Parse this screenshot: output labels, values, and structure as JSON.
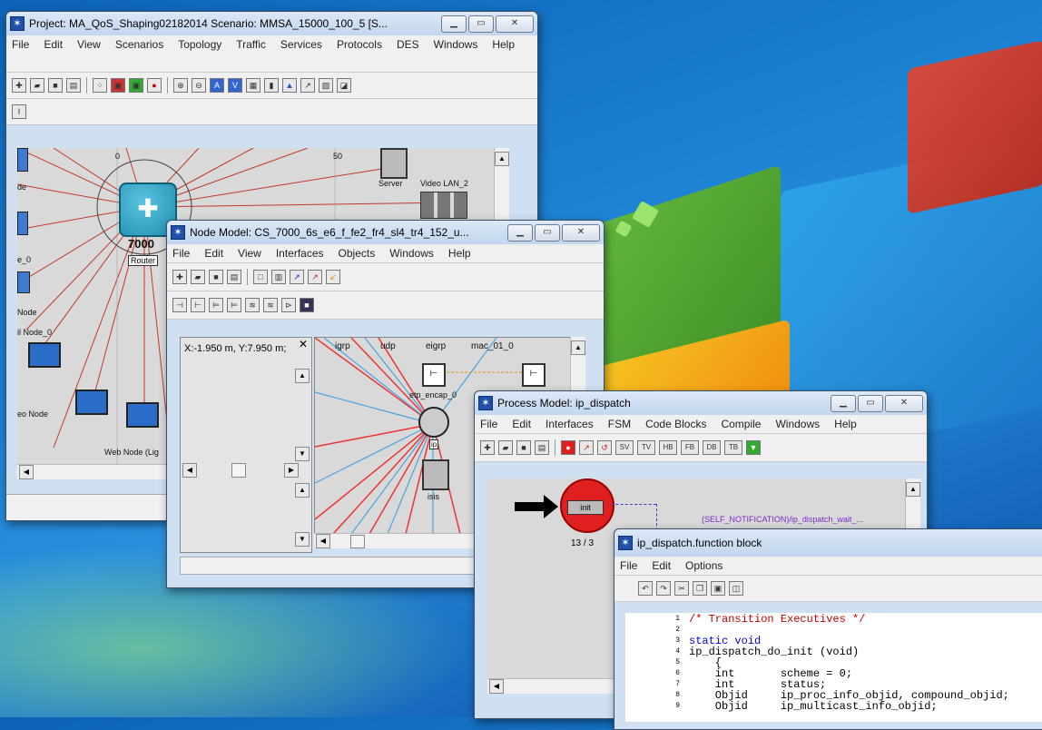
{
  "project_window": {
    "title": "Project: MA_QoS_Shaping02182014 Scenario: MMSA_15000_100_5  [S...",
    "menu": [
      "File",
      "Edit",
      "View",
      "Scenarios",
      "Topology",
      "Traffic",
      "Services",
      "Protocols",
      "DES",
      "Windows",
      "Help"
    ],
    "labels": {
      "ruler_0": "0",
      "ruler_50": "50",
      "server": "Server",
      "video_lan": "Video LAN_2",
      "router_name": "7000",
      "router_tip": "Router",
      "node_left_1": "de",
      "node_left_2": "e_0",
      "node_left_3": "Node",
      "node_left_4": "il Node_0",
      "video_node": "eo Node",
      "web_node": "Web Node (Lig"
    }
  },
  "node_window": {
    "title": "Node Model: CS_7000_6s_e6_f_fe2_fr4_sl4_tr4_152_u...",
    "menu": [
      "File",
      "Edit",
      "View",
      "Interfaces",
      "Objects",
      "Windows",
      "Help"
    ],
    "coords": "X:-1.950 m, Y:7.950 m;",
    "labels": {
      "igrp": "igrp",
      "udp": "udp",
      "eigrp": "eigrp",
      "mac": "mac_01_0",
      "ip_encap": "etp_encap_0",
      "ip": "ip",
      "isis": "isis"
    }
  },
  "process_window": {
    "title": "Process Model: ip_dispatch",
    "menu": [
      "File",
      "Edit",
      "Interfaces",
      "FSM",
      "Code Blocks",
      "Compile",
      "Windows",
      "Help"
    ],
    "toolbar_text": [
      "SV",
      "TV",
      "HB",
      "FB",
      "DB",
      "TB"
    ],
    "state_label": "init",
    "state_count": "13 / 3",
    "transition_text": "(SELF_NOTIFICATION)/ip_dispatch_wait_..."
  },
  "function_window": {
    "title": "ip_dispatch.function block",
    "menu": [
      "File",
      "Edit",
      "Options"
    ],
    "code_lines": [
      {
        "n": "1",
        "text": "/* Transition Executives */",
        "color": "#c00000"
      },
      {
        "n": "2",
        "text": "",
        "color": "#000000"
      },
      {
        "n": "3",
        "text": "static void",
        "color": "#0000cc"
      },
      {
        "n": "4",
        "text": "ip_dispatch_do_init (void)",
        "color": "#000000"
      },
      {
        "n": "5",
        "text": "    {",
        "color": "#000000"
      },
      {
        "n": "6",
        "text": "    int       scheme = 0;",
        "color": "#000000"
      },
      {
        "n": "7",
        "text": "    int       status;",
        "color": "#000000"
      },
      {
        "n": "8",
        "text": "    Objid     ip_proc_info_objid, compound_objid;",
        "color": "#000000"
      },
      {
        "n": "9",
        "text": "    Objid     ip_multicast_info_objid;",
        "color": "#000000"
      }
    ],
    "type_keywords": [
      "int",
      "int",
      "Objid",
      "Objid"
    ]
  },
  "colors": {
    "title_blue": "#2050a8",
    "router_teal": "#1f8fb0",
    "state_red": "#e02020",
    "link_red": "#c0392b",
    "link_blue": "#4aa3e0"
  }
}
